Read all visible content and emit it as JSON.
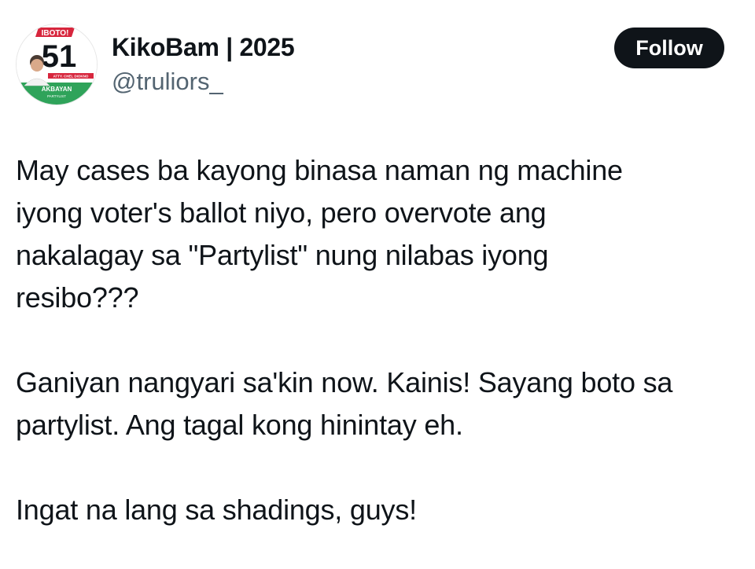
{
  "author": {
    "display_name": "KikoBam | 2025",
    "handle": "@truliors_",
    "avatar_icon": "campaign-poster-avatar-icon",
    "avatar_text": {
      "badge": "IBOTO!",
      "number": "51",
      "name_tag": "ATTY. CHEL DIOKNO",
      "party": "AKBAYAN",
      "party_sub": "PARTYLIST"
    }
  },
  "follow_button": {
    "label": "Follow"
  },
  "tweet": {
    "paragraphs": [
      "May cases ba kayong binasa naman ng machine\niyong voter's ballot niyo, pero overvote ang\nnakalagay sa \"Partylist\" nung nilabas iyong\nresibo???",
      "Ganiyan nangyari sa'kin now. Kainis! Sayang boto sa\npartylist. Ang tagal kong hinintay eh.",
      "Ingat na lang sa shadings, guys!"
    ]
  },
  "colors": {
    "text": "#0f1419",
    "secondary_text": "#536471",
    "button_bg": "#0f1419",
    "button_text": "#ffffff",
    "avatar_red": "#d7263d",
    "avatar_green": "#2fa35a"
  }
}
